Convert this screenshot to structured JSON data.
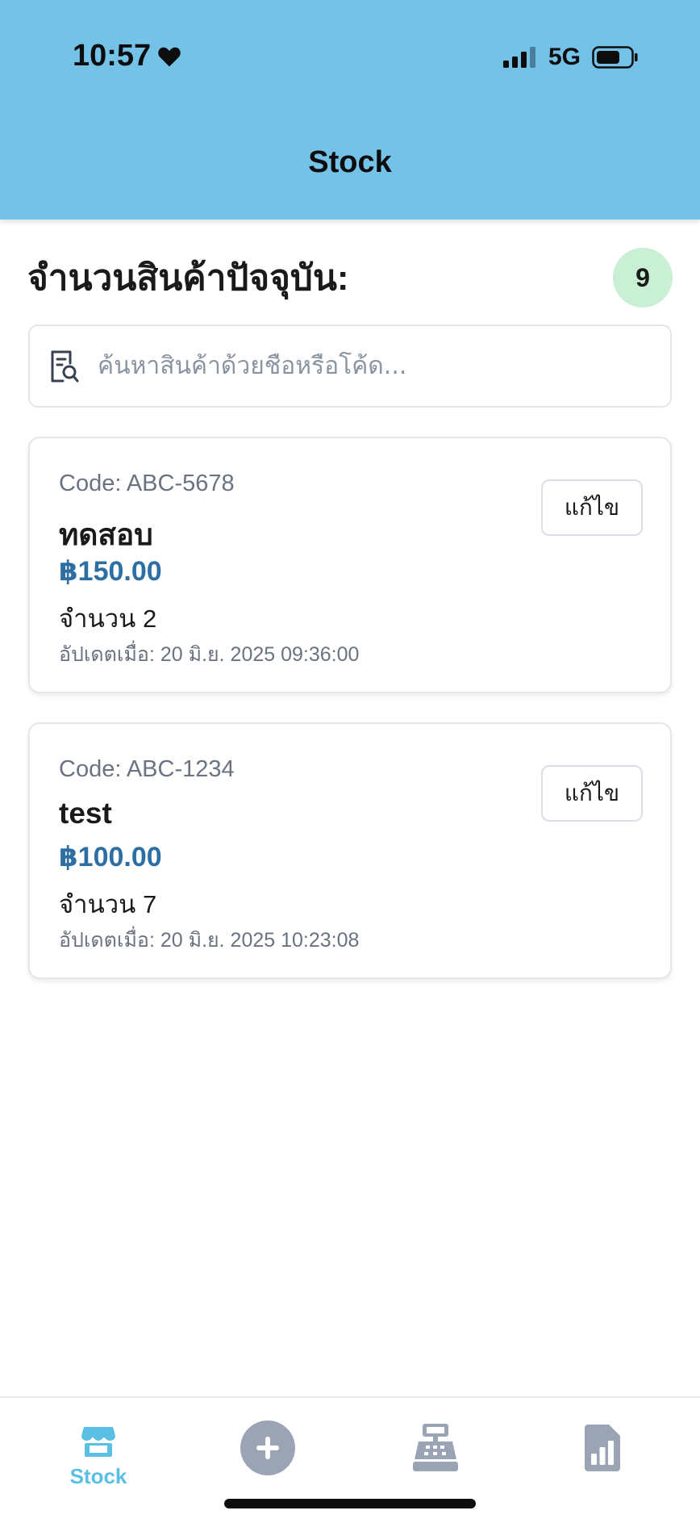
{
  "status_bar": {
    "time": "10:57",
    "network": "5G",
    "icons": [
      "heart-icon",
      "signal-icon",
      "battery-icon"
    ]
  },
  "header": {
    "title": "Stock",
    "background": "#74c2e8"
  },
  "summary": {
    "title": "จำนวนสินค้าปัจจุบัน:",
    "count": "9",
    "badge_color": "#c9f0d4"
  },
  "search": {
    "placeholder": "ค้นหาสินค้าด้วยชื่อหรือโค้ด...",
    "value": ""
  },
  "products": [
    {
      "code": "Code: ABC-5678",
      "name": "ทดสอบ",
      "price": "฿150.00",
      "quantity": "จำนวน 2",
      "updated": "อัปเดตเมื่อ: 20 มิ.ย. 2025 09:36:00",
      "edit_label": "แก้ไข"
    },
    {
      "code": "Code: ABC-1234",
      "name": "test",
      "price": "฿100.00",
      "quantity": "จำนวน 7",
      "updated": "อัปเดตเมื่อ: 20 มิ.ย. 2025 10:23:08",
      "edit_label": "แก้ไข"
    }
  ],
  "tabbar": {
    "stock_label": "Stock",
    "active_color": "#5bbfe3",
    "inactive_color": "#9aa4b4",
    "icons": [
      "store-icon",
      "add-circle-icon",
      "cash-register-icon",
      "report-chart-icon"
    ]
  },
  "colors": {
    "price": "#2e6fa3",
    "muted_text": "#6b7280"
  }
}
